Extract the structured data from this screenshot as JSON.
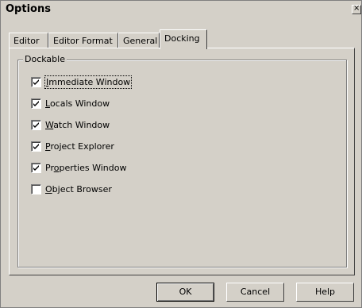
{
  "window": {
    "title": "Options",
    "close_glyph": "×"
  },
  "tabs": [
    {
      "label": "Editor",
      "active": false
    },
    {
      "label": "Editor Format",
      "active": false
    },
    {
      "label": "General",
      "active": false
    },
    {
      "label": "Docking",
      "active": true
    }
  ],
  "group": {
    "label": "Dockable",
    "options": [
      {
        "acc": "I",
        "rest": "mmediate Window",
        "checked": true
      },
      {
        "acc": "L",
        "rest": "ocals Window",
        "checked": true
      },
      {
        "acc": "W",
        "rest": "atch Window",
        "checked": true
      },
      {
        "acc": "P",
        "rest": "roject Explorer",
        "checked": true
      },
      {
        "pre": "Pr",
        "acc": "o",
        "rest": "perties Window",
        "checked": true
      },
      {
        "acc": "O",
        "rest": "bject Browser",
        "checked": false
      }
    ]
  },
  "buttons": {
    "ok": "OK",
    "cancel": "Cancel",
    "help": "Help"
  },
  "colors": {
    "face": "#d4d0c8",
    "shadow": "#808080",
    "highlight": "#ffffff"
  }
}
